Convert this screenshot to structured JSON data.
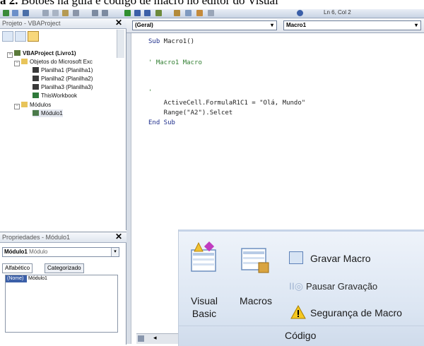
{
  "caption": {
    "label": "a 2.",
    "text": " Botões na guia e código de macro no editor do Visual"
  },
  "toolbar": {
    "status": "Ln 6, Col 2"
  },
  "project_panel": {
    "title": "Projeto - VBAProject",
    "close": "✕",
    "tree": {
      "root": "VBAProject (Livro1)",
      "objects_folder": "Objetos do Microsoft Exc",
      "sheets": [
        "Planilha1 (Planilha1)",
        "Planilha2 (Planilha2)",
        "Planilha3 (Planilha3)"
      ],
      "workbook": "ThisWorkbook",
      "modules_folder": "Módulos",
      "module": "Módulo1"
    }
  },
  "properties_panel": {
    "title": "Propriedades - Módulo1",
    "close": "✕",
    "selected_object": "Módulo1",
    "selected_type": "Módulo",
    "tabs": [
      "Alfabético",
      "Categorizado"
    ],
    "rows": [
      {
        "name": "(Nome)",
        "value": "Módulo1"
      }
    ]
  },
  "code_window": {
    "object_combo": "(Geral)",
    "procedure_combo": "Macro1",
    "lines": {
      "l1_kw": "Sub",
      "l1_rest": " Macro1()",
      "l3": "' Macro1 Macro",
      "l5": "'",
      "l6": "    ActiveCell.FormulaR1C1 = \"Olá, Mundo\"",
      "l7": "    Range(\"A2\").Selcet",
      "l8": "End Sub"
    }
  },
  "ribbon": {
    "visual_basic_line1": "Visual",
    "visual_basic_line2": "Basic",
    "macros": "Macros",
    "record_macro": "Gravar Macro",
    "pause_recording": "Pausar Gravação",
    "macro_security": "Segurança de Macro",
    "group_label": "Código"
  },
  "colors": {
    "keyword": "#1f2f8c",
    "comment": "#2f7d2f",
    "ribbon_bg": "#dbe5f2",
    "selection": "#3b5fa8"
  }
}
